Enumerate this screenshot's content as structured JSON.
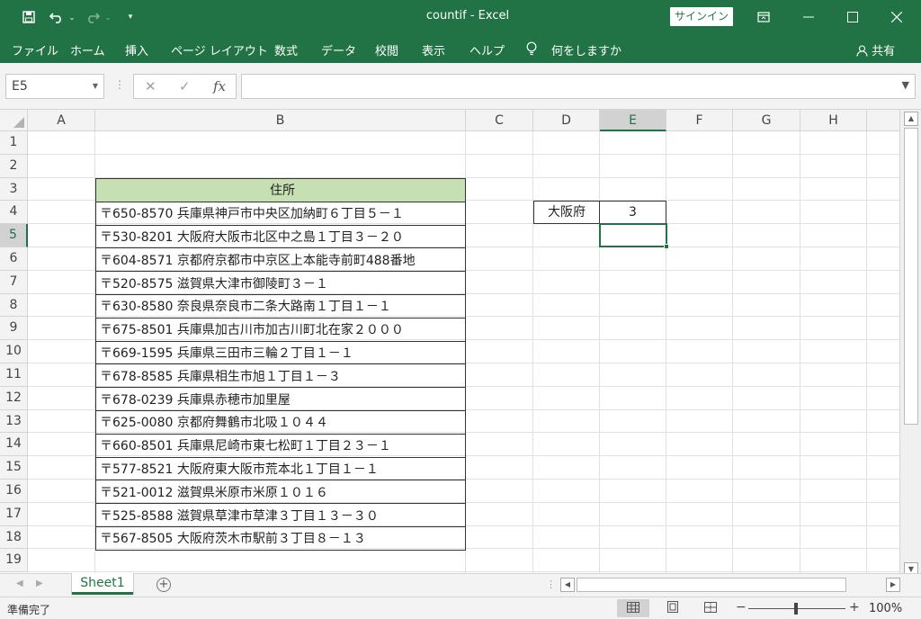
{
  "window": {
    "title": "countif  -  Excel",
    "signin_label": "サインイン"
  },
  "ribbon": {
    "tabs": [
      "ファイル",
      "ホーム",
      "挿入",
      "ページ レイアウト",
      "数式",
      "データ",
      "校閲",
      "表示",
      "ヘルプ"
    ],
    "tell_me": "何をしますか",
    "share": "共有"
  },
  "formula_bar": {
    "name_box": "E5",
    "formula": ""
  },
  "sheet": {
    "columns": [
      "A",
      "B",
      "C",
      "D",
      "E",
      "F",
      "G",
      "H"
    ],
    "selected_column": "E",
    "rows": [
      "1",
      "2",
      "3",
      "4",
      "5",
      "6",
      "7",
      "8",
      "9",
      "10",
      "11",
      "12",
      "13",
      "14",
      "15",
      "16",
      "17",
      "18",
      "19"
    ],
    "selected_row": "5",
    "table_header": "住所",
    "addresses": [
      "〒650-8570 兵庫県神戸市中央区加納町６丁目５－１",
      "〒530-8201 大阪府大阪市北区中之島１丁目３－２０",
      "〒604-8571 京都府京都市中京区上本能寺前町488番地",
      "〒520-8575 滋賀県大津市御陵町３－１",
      "〒630-8580 奈良県奈良市二条大路南１丁目１－１",
      "〒675-8501 兵庫県加古川市加古川町北在家２０００",
      "〒669-1595 兵庫県三田市三輪２丁目１－１",
      "〒678-8585 兵庫県相生市旭１丁目１－３",
      "〒678-0239 兵庫県赤穂市加里屋",
      "〒625-0080 京都府舞鶴市北吸１０４４",
      "〒660-8501 兵庫県尼崎市東七松町１丁目２３－１",
      "〒577-8521 大阪府東大阪市荒本北１丁目１－１",
      "〒521-0012 滋賀県米原市米原１０１６",
      "〒525-8588 滋賀県草津市草津３丁目１３－３０",
      "〒567-8505 大阪府茨木市駅前３丁目８－１３"
    ],
    "d4": "大阪府",
    "e4": "3",
    "tab_name": "Sheet1"
  },
  "status": {
    "text": "準備完了",
    "zoom": "100%"
  },
  "colors": {
    "accent": "#217346",
    "header_fill": "#c6e0b4"
  }
}
